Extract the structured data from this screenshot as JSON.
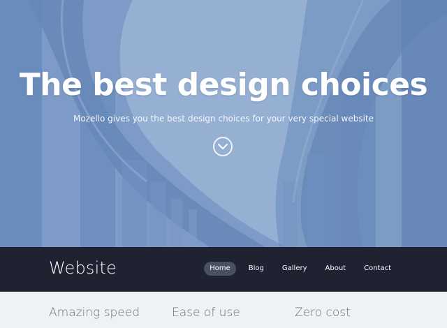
{
  "hero": {
    "title": "The best design choices",
    "subtitle": "Mozello gives you the best design choices for your very special website",
    "scroll_icon": "chevron-down-circle-icon"
  },
  "header": {
    "logo": "Website",
    "nav": [
      {
        "label": "Home",
        "active": true
      },
      {
        "label": "Blog",
        "active": false
      },
      {
        "label": "Gallery",
        "active": false
      },
      {
        "label": "About",
        "active": false
      },
      {
        "label": "Contact",
        "active": false
      }
    ]
  },
  "features": [
    {
      "title": "Amazing speed"
    },
    {
      "title": "Ease of use"
    },
    {
      "title": "Zero cost"
    }
  ],
  "colors": {
    "header_bg": "#1f2230",
    "nav_active_bg": "#4a4f61",
    "features_bg": "#eef2f5",
    "feature_text": "#6a7385",
    "hero_tint": "#8eaed6"
  }
}
